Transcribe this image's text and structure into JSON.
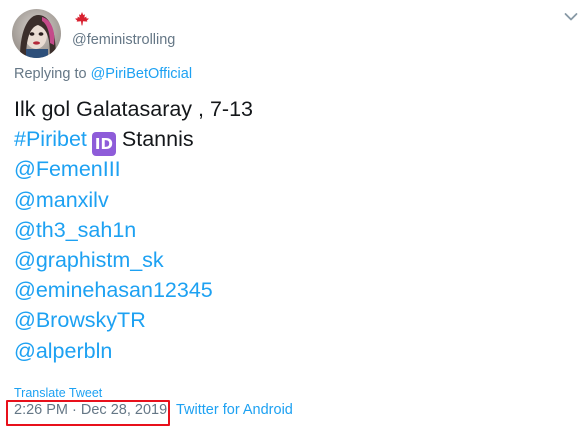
{
  "user": {
    "handle": "@feministrolling",
    "flag_icon": "maple-leaf-icon"
  },
  "reply": {
    "prefix": "Replying to ",
    "target": "@PiriBetOfficial"
  },
  "tweet": {
    "line1": "Ilk gol Galatasaray , 7-13",
    "hashtag": "#Piribet",
    "id_emoji": "ID",
    "after_emoji": "Stannis",
    "mentions": [
      "@FemenIII",
      "@manxilv",
      "@th3_sah1n",
      "@graphistm_sk",
      "@eminehasan12345",
      "@BrowskyTR",
      "@alperbln"
    ]
  },
  "translate_label": "Translate Tweet",
  "timestamp": "2:26 PM · Dec 28, 2019",
  "separator": " · ",
  "source": "Twitter for Android",
  "colors": {
    "link": "#1da1f2",
    "muted": "#657786",
    "text": "#14171a",
    "highlight": "#e8101b",
    "id_emoji_bg": "#8e5cd9"
  }
}
